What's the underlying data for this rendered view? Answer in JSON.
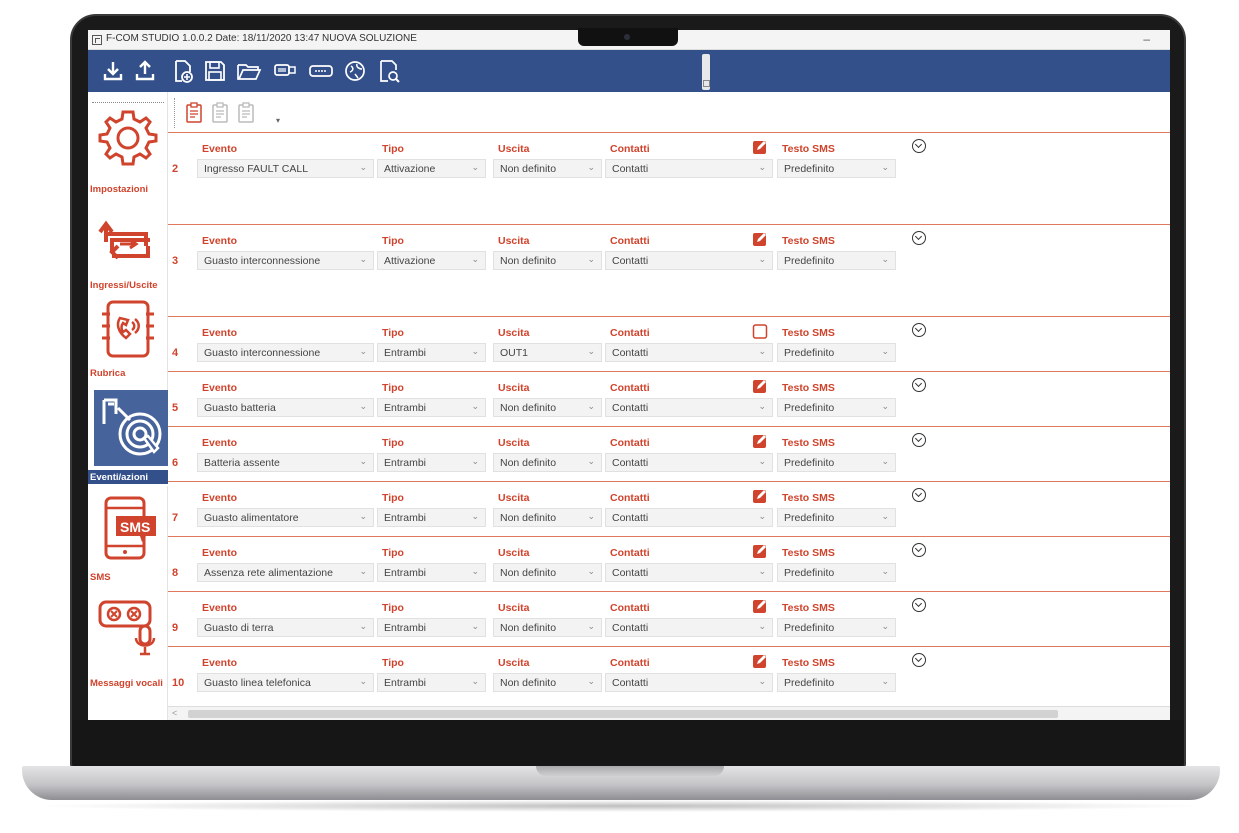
{
  "window": {
    "title": "F-COM STUDIO 1.0.0.2 Date: 18/11/2020 13:47 NUOVA SOLUZIONE",
    "minimize_label": "–"
  },
  "toolbar": {
    "buttons": [
      {
        "name": "download-icon"
      },
      {
        "name": "upload-icon"
      },
      {
        "name": "new-file-icon"
      },
      {
        "name": "save-icon"
      },
      {
        "name": "open-folder-icon"
      },
      {
        "name": "usb-icon"
      },
      {
        "name": "serial-port-icon"
      },
      {
        "name": "web-update-icon"
      },
      {
        "name": "inspect-file-icon"
      }
    ]
  },
  "sidebar": {
    "items": [
      {
        "label": "Impostazioni",
        "icon": "gear-icon",
        "active": false
      },
      {
        "label": "Ingressi/Uscite",
        "icon": "io-arrows-icon",
        "active": false
      },
      {
        "label": "Rubrica",
        "icon": "phonebook-icon",
        "active": false
      },
      {
        "label": "Eventi/azioni",
        "icon": "touch-event-icon",
        "active": true
      },
      {
        "label": "SMS",
        "icon": "sms-icon",
        "active": false
      },
      {
        "label": "Messaggi vocali",
        "icon": "voice-message-icon",
        "active": false
      }
    ]
  },
  "labels": {
    "evento": "Evento",
    "tipo": "Tipo",
    "uscita": "Uscita",
    "contatti": "Contatti",
    "testo_sms": "Testo SMS"
  },
  "rows": [
    {
      "num": "2",
      "evento": "Ingresso FAULT CALL",
      "tipo": "Attivazione",
      "uscita": "Non definito",
      "contatti": "Contatti",
      "testo_sms": "Predefinito",
      "edit_filled": true
    },
    {
      "num": "3",
      "evento": "Guasto interconnessione",
      "tipo": "Attivazione",
      "uscita": "Non definito",
      "contatti": "Contatti",
      "testo_sms": "Predefinito",
      "edit_filled": true
    },
    {
      "num": "4",
      "evento": "Guasto interconnessione",
      "tipo": "Entrambi",
      "uscita": "OUT1",
      "contatti": "Contatti",
      "testo_sms": "Predefinito",
      "edit_filled": false
    },
    {
      "num": "5",
      "evento": "Guasto batteria",
      "tipo": "Entrambi",
      "uscita": "Non definito",
      "contatti": "Contatti",
      "testo_sms": "Predefinito",
      "edit_filled": true
    },
    {
      "num": "6",
      "evento": "Batteria assente",
      "tipo": "Entrambi",
      "uscita": "Non definito",
      "contatti": "Contatti",
      "testo_sms": "Predefinito",
      "edit_filled": true
    },
    {
      "num": "7",
      "evento": "Guasto alimentatore",
      "tipo": "Entrambi",
      "uscita": "Non definito",
      "contatti": "Contatti",
      "testo_sms": "Predefinito",
      "edit_filled": true
    },
    {
      "num": "8",
      "evento": "Assenza rete alimentazione",
      "tipo": "Entrambi",
      "uscita": "Non definito",
      "contatti": "Contatti",
      "testo_sms": "Predefinito",
      "edit_filled": true
    },
    {
      "num": "9",
      "evento": "Guasto di terra",
      "tipo": "Entrambi",
      "uscita": "Non definito",
      "contatti": "Contatti",
      "testo_sms": "Predefinito",
      "edit_filled": true
    },
    {
      "num": "10",
      "evento": "Guasto linea telefonica",
      "tipo": "Entrambi",
      "uscita": "Non definito",
      "contatti": "Contatti",
      "testo_sms": "Predefinito",
      "edit_filled": true
    }
  ],
  "colors": {
    "accent": "#d0432c",
    "toolbar": "#33508a",
    "active_nav": "#46639b"
  }
}
